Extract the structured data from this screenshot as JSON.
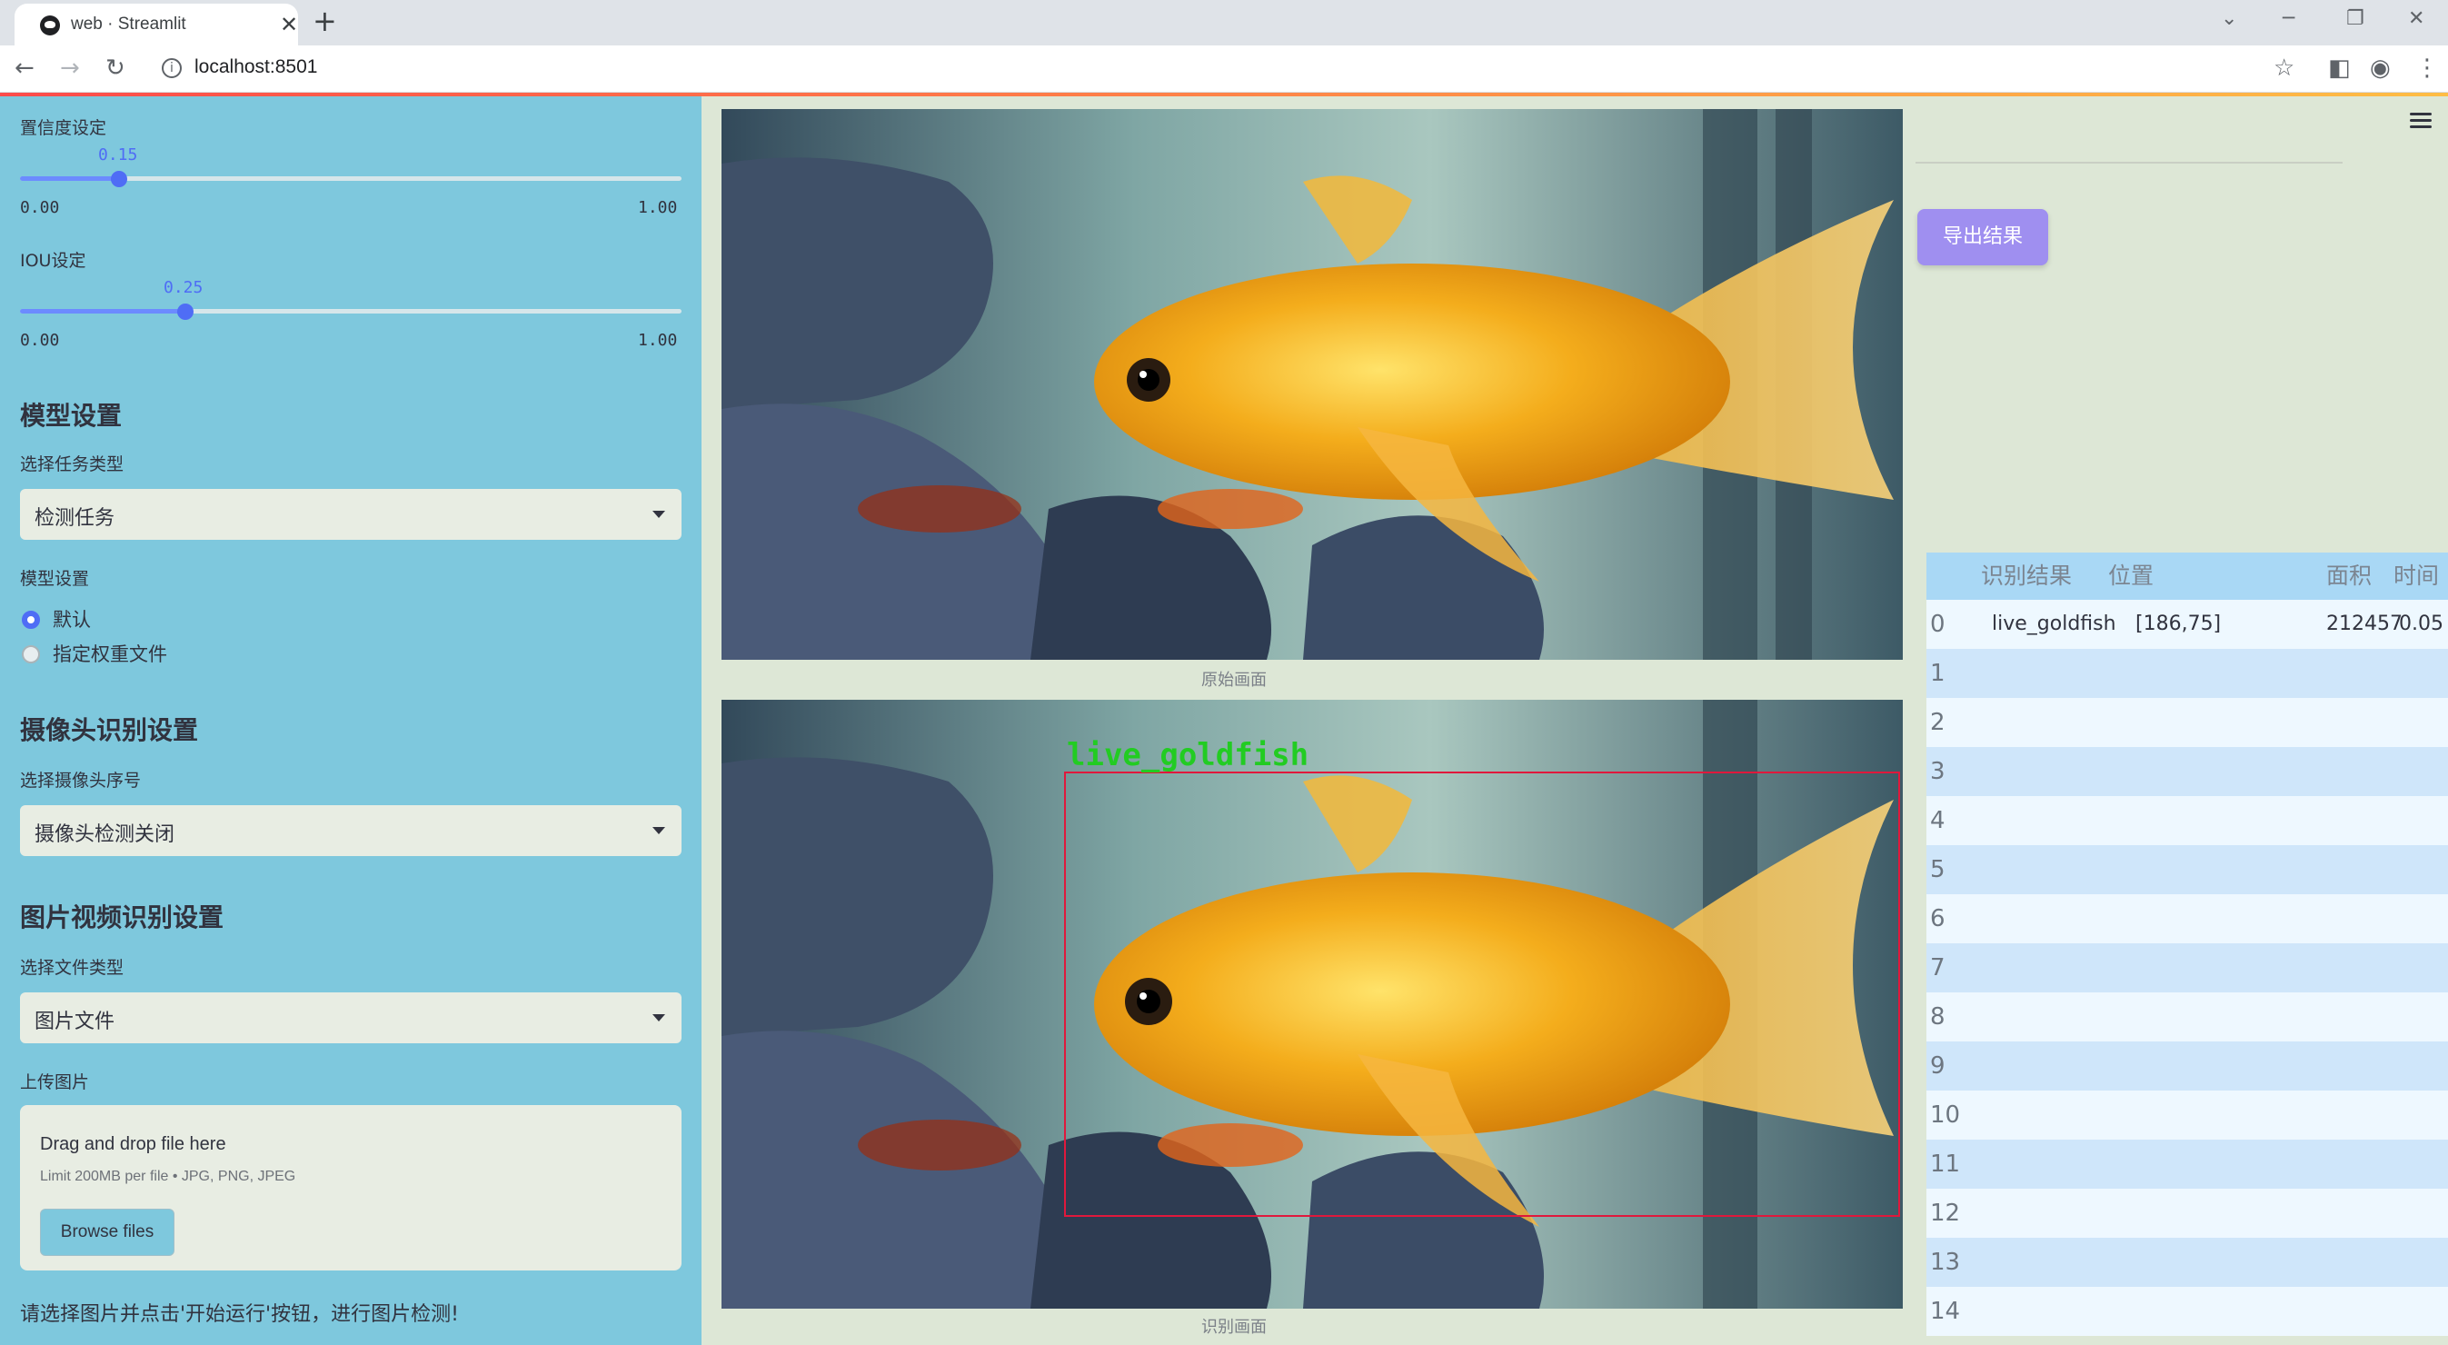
{
  "browser": {
    "tab_title": "web · Streamlit",
    "url": "localhost:8501"
  },
  "sidebar": {
    "confidence": {
      "label": "置信度设定",
      "value": "0.15",
      "fraction": 0.15,
      "min": "0.00",
      "max": "1.00"
    },
    "iou": {
      "label": "IOU设定",
      "value": "0.25",
      "fraction": 0.25,
      "min": "0.00",
      "max": "1.00"
    },
    "model_heading": "模型设置",
    "task_label": "选择任务类型",
    "task_value": "检测任务",
    "model_label": "模型设置",
    "model_options": [
      "默认",
      "指定权重文件"
    ],
    "model_selected": 0,
    "camera_heading": "摄像头识别设置",
    "camera_label": "选择摄像头序号",
    "camera_value": "摄像头检测关闭",
    "media_heading": "图片视频识别设置",
    "filetype_label": "选择文件类型",
    "filetype_value": "图片文件",
    "upload_label": "上传图片",
    "upload": {
      "drag_text": "Drag and drop file here",
      "limit_text": "Limit 200MB per file • JPG, PNG, JPEG",
      "browse_label": "Browse files"
    },
    "hint": "请选择图片并点击'开始运行'按钮，进行图片检测!"
  },
  "main": {
    "original_caption": "原始画面",
    "detected_caption": "识别画面",
    "detection_label": "live_goldfish",
    "export_label": "导出结果",
    "colors": {
      "accent": "#4f6df5",
      "box": "#e0183c",
      "label": "#22cc22"
    }
  },
  "table": {
    "columns": [
      "识别结果",
      "位置",
      "面积",
      "时间"
    ],
    "rows": [
      {
        "index": "0",
        "result": "live_goldfish",
        "position": "[186,75]",
        "area": "212457",
        "time": "0.05"
      },
      {
        "index": "1"
      },
      {
        "index": "2"
      },
      {
        "index": "3"
      },
      {
        "index": "4"
      },
      {
        "index": "5"
      },
      {
        "index": "6"
      },
      {
        "index": "7"
      },
      {
        "index": "8"
      },
      {
        "index": "9"
      },
      {
        "index": "10"
      },
      {
        "index": "11"
      },
      {
        "index": "12"
      },
      {
        "index": "13"
      },
      {
        "index": "14"
      }
    ]
  }
}
